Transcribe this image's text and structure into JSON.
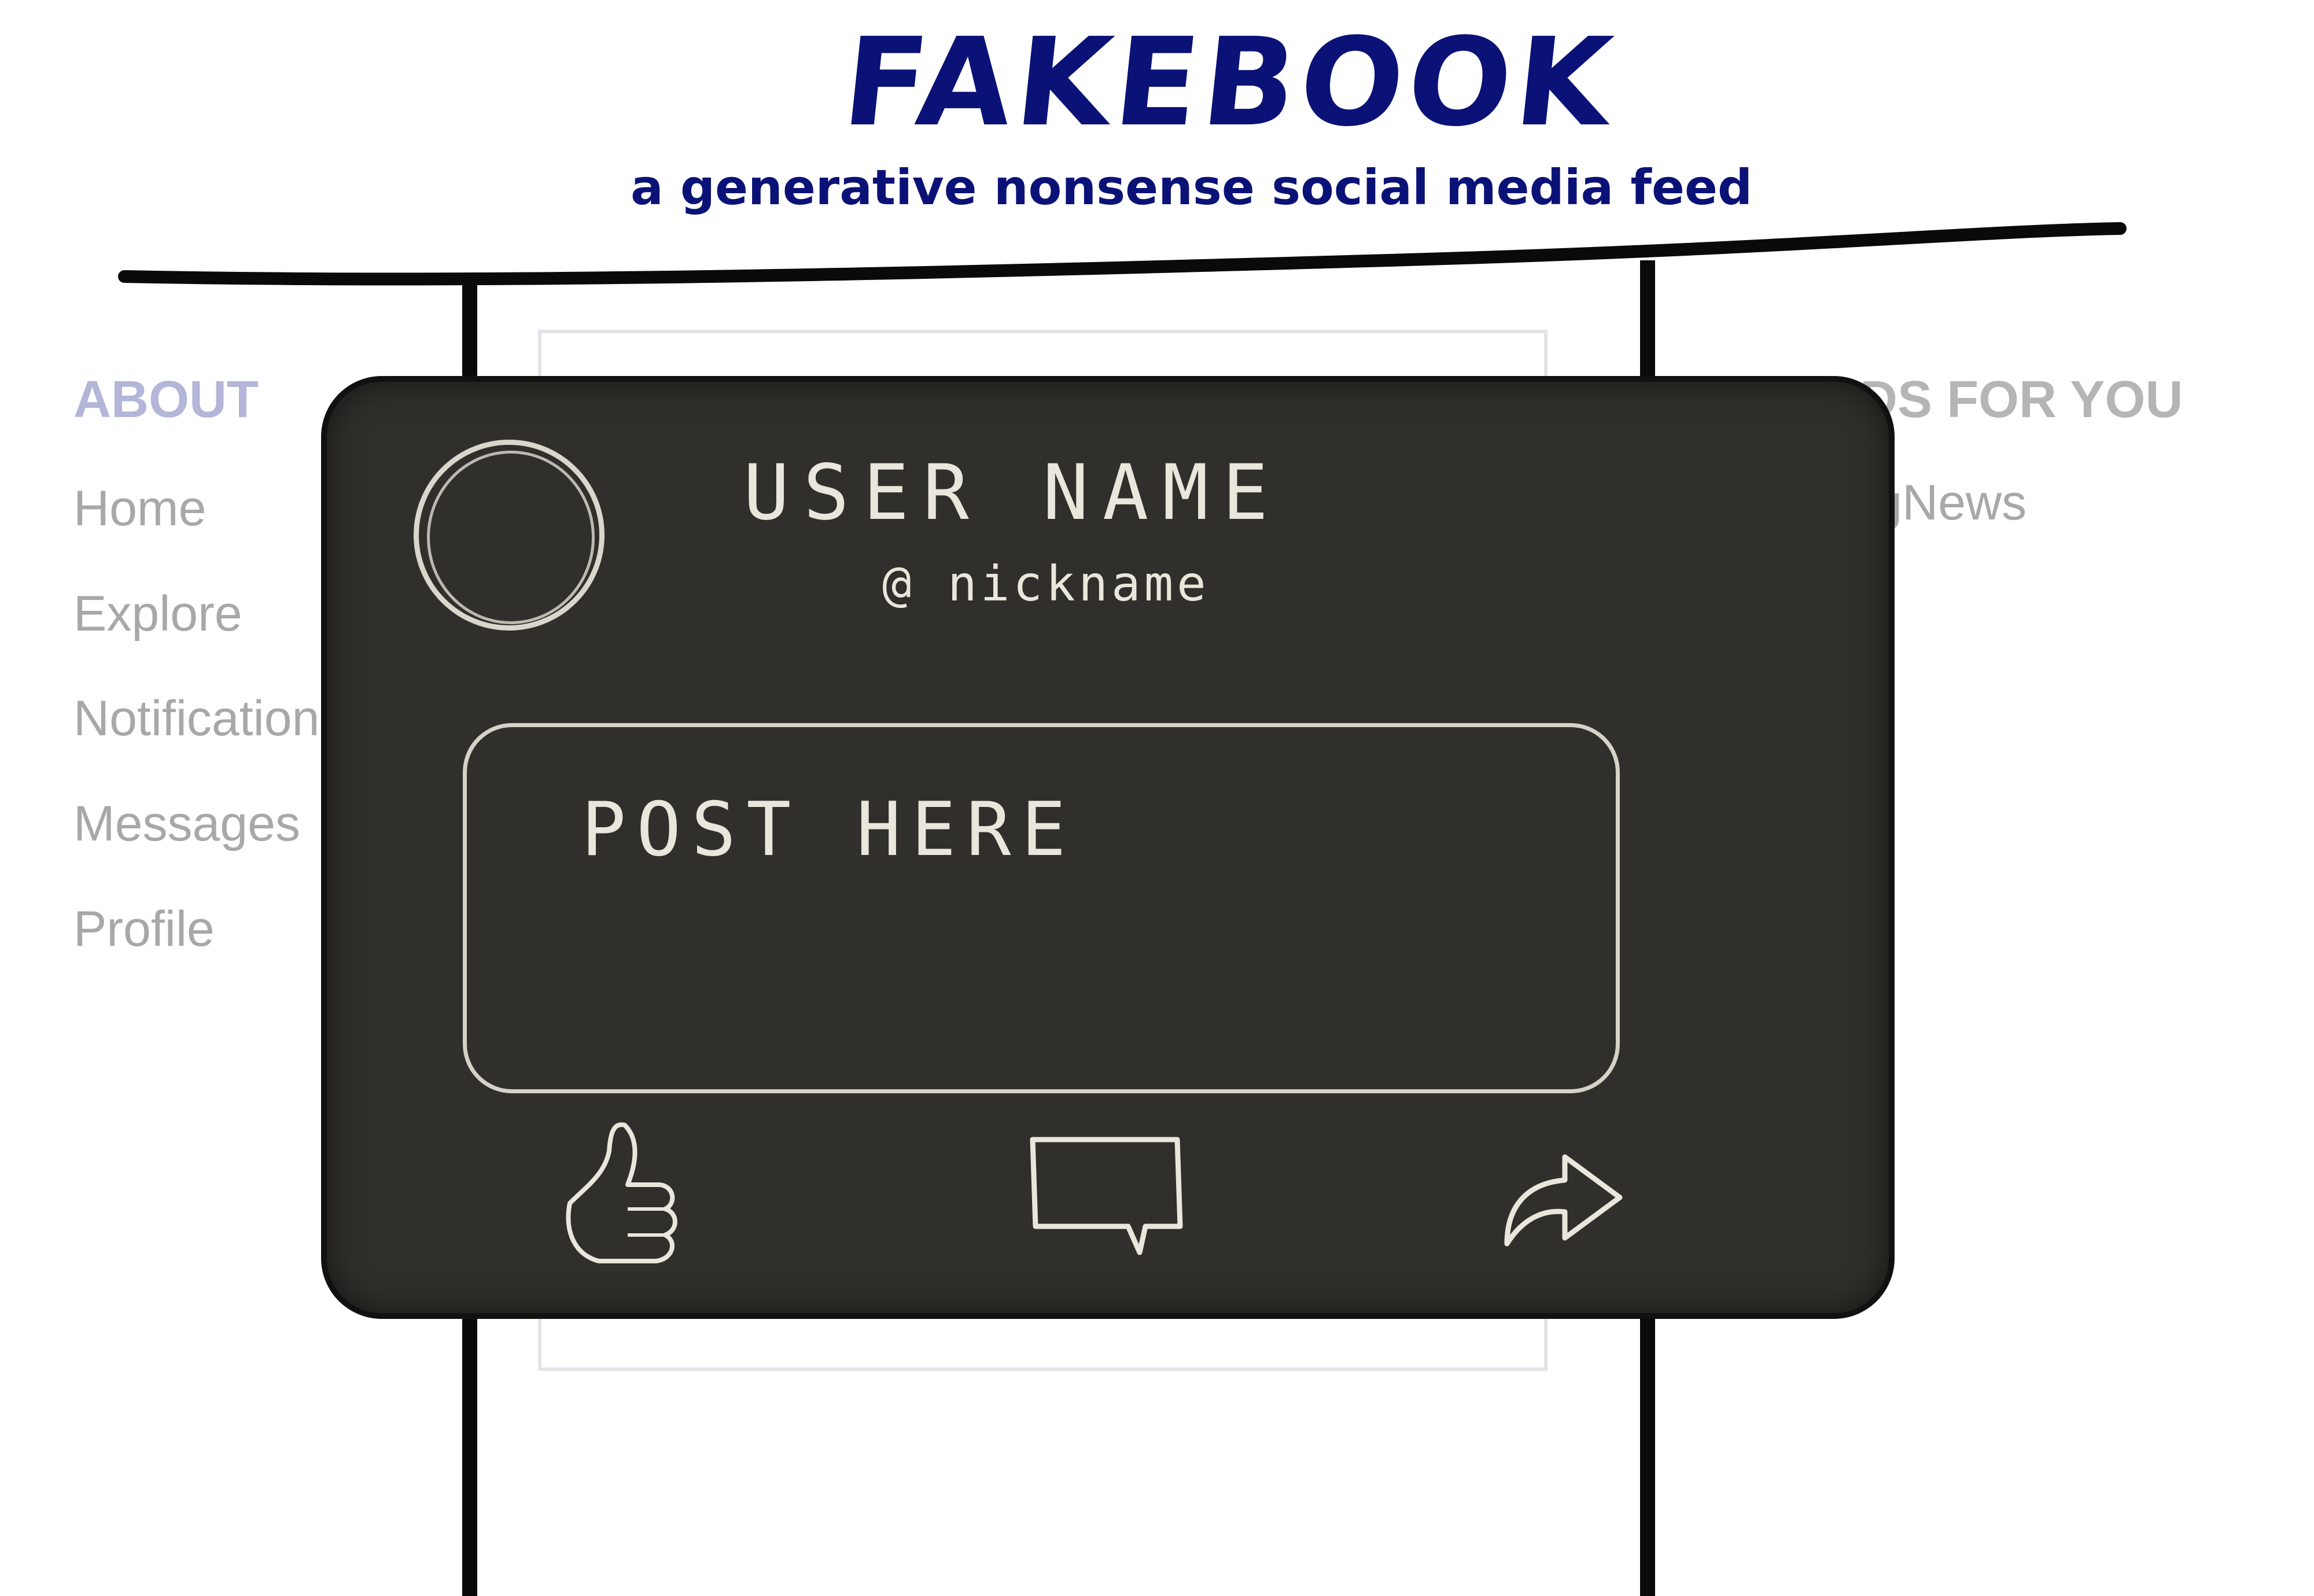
{
  "header": {
    "title": "FAKEBOOK",
    "subtitle": "a generative nonsense social media feed"
  },
  "left_sidebar": {
    "heading": "ABOUT",
    "items": [
      "Home",
      "Explore",
      "Notifications",
      "Messages",
      "Profile"
    ]
  },
  "right_sidebar": {
    "heading": "FEEDS FOR YOU",
    "items": [
      "FakingNews"
    ]
  },
  "post_mockup": {
    "user_name": "USER NAME",
    "nickname": "@ nickname",
    "post_text": "POST HERE",
    "actions": [
      "thumbs-up-icon",
      "comment-icon",
      "share-icon"
    ]
  },
  "colors": {
    "brand": "#0b1277",
    "chalkboard": "#302f2b",
    "chalk": "#e9e6dc",
    "muted_text": "#a8a8a8",
    "heading_tint": "#b3b6d8"
  }
}
